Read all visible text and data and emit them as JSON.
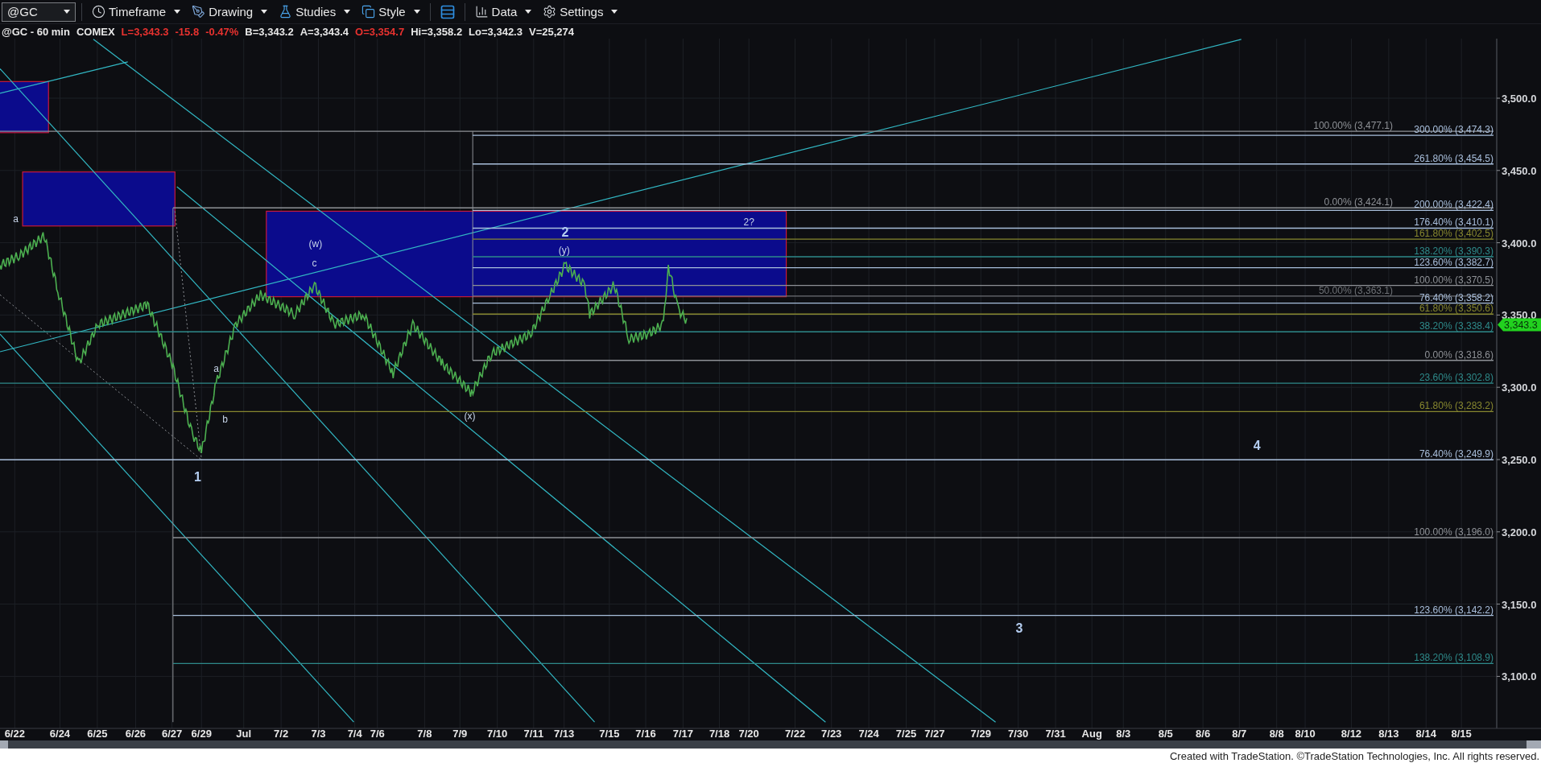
{
  "toolbar": {
    "symbol": "@GC",
    "menus": [
      {
        "label": "Timeframe",
        "kind": "clock"
      },
      {
        "label": "Drawing",
        "kind": "pen"
      },
      {
        "label": "Studies",
        "kind": "flask"
      },
      {
        "label": "Style",
        "kind": "layers"
      },
      {
        "label": "Data",
        "kind": "bars"
      },
      {
        "label": "Settings",
        "kind": "gear"
      }
    ]
  },
  "quote_line": [
    {
      "text": "@GC - 60 min",
      "color": "#e8e8e8"
    },
    {
      "text": "COMEX",
      "color": "#e8e8e8"
    },
    {
      "text": "L=3,343.3",
      "color": "#e8322f"
    },
    {
      "text": "-15.8",
      "color": "#e8322f"
    },
    {
      "text": "-0.47%",
      "color": "#e8322f"
    },
    {
      "text": "B=3,343.2",
      "color": "#e8e8e8"
    },
    {
      "text": "A=3,343.4",
      "color": "#e8e8e8"
    },
    {
      "text": "O=3,354.7",
      "color": "#e8322f"
    },
    {
      "text": "Hi=3,358.2",
      "color": "#e8e8e8"
    },
    {
      "text": "Lo=3,342.3",
      "color": "#e8e8e8"
    },
    {
      "text": "V=25,274",
      "color": "#e8e8e8"
    }
  ],
  "fib_levels": [
    {
      "label": "100.00% (3,477.1)",
      "color": "#8e9196"
    },
    {
      "label": "300.00% (3,474.3)",
      "color": "#a9bfdc"
    },
    {
      "label": "261.80% (3,454.5)",
      "color": "#a9bfdc"
    },
    {
      "label": "0.00% (3,424.1)",
      "color": "#8e9196"
    },
    {
      "label": "200.00% (3,422.4)",
      "color": "#a9bfdc"
    },
    {
      "label": "176.40% (3,410.1)",
      "color": "#a9bfdc"
    },
    {
      "label": "161.80% (3,402.5)",
      "color": "#87872f"
    },
    {
      "label": "138.20% (3,390.3)",
      "color": "#2e8a8a"
    },
    {
      "label": "123.60% (3,382.7)",
      "color": "#a9bfdc"
    },
    {
      "label": "100.00% (3,370.5)",
      "color": "#8e9196"
    },
    {
      "label": "50.00% (3,363.1)",
      "color": "#6e7176"
    },
    {
      "label": "76.40% (3,358.2)",
      "color": "#a9bfdc"
    },
    {
      "label": "61.80% (3,350.6)",
      "color": "#87872f"
    },
    {
      "label": "38.20% (3,338.4)",
      "color": "#2e8a8a"
    },
    {
      "label": "0.00% (3,318.6)",
      "color": "#8e9196"
    },
    {
      "label": "23.60% (3,302.8)",
      "color": "#2e8a8a"
    },
    {
      "label": "61.80% (3,283.2)",
      "color": "#87872f"
    },
    {
      "label": "76.40% (3,249.9)",
      "color": "#a9bfdc"
    },
    {
      "label": "100.00% (3,196.0)",
      "color": "#8e9196"
    },
    {
      "label": "123.60% (3,142.2)",
      "color": "#a9bfdc"
    },
    {
      "label": "138.20% (3,108.9)",
      "color": "#2e8a8a"
    }
  ],
  "wave_labels": [
    {
      "text": "a",
      "kind": "minor"
    },
    {
      "text": "(w)",
      "kind": "minor"
    },
    {
      "text": "c",
      "kind": "minor"
    },
    {
      "text": "2",
      "kind": "major"
    },
    {
      "text": "(y)",
      "kind": "minor"
    },
    {
      "text": "2?",
      "kind": "minor"
    },
    {
      "text": "a",
      "kind": "minor"
    },
    {
      "text": "b",
      "kind": "minor"
    },
    {
      "text": "(x)",
      "kind": "minor"
    },
    {
      "text": "1",
      "kind": "major"
    },
    {
      "text": "4",
      "kind": "major"
    },
    {
      "text": "3",
      "kind": "major"
    }
  ],
  "price_axis": [
    "3,500.0",
    "3,450.0",
    "3,400.0",
    "3,350.0",
    "3,300.0",
    "3,250.0",
    "3,200.0",
    "3,150.0",
    "3,100.0"
  ],
  "last_price": "3,343.3",
  "date_axis": [
    "6/22",
    "6/24",
    "6/25",
    "6/26",
    "6/27",
    "6/29",
    "Jul",
    "7/2",
    "7/3",
    "7/4",
    "7/6",
    "7/8",
    "7/9",
    "7/10",
    "7/11",
    "7/13",
    "7/15",
    "7/16",
    "7/17",
    "7/18",
    "7/20",
    "7/22",
    "7/23",
    "7/24",
    "7/25",
    "7/27",
    "7/29",
    "7/30",
    "7/31",
    "Aug",
    "8/3",
    "8/5",
    "8/6",
    "8/7",
    "8/8",
    "8/10",
    "8/12",
    "8/13",
    "8/14",
    "8/15"
  ],
  "footer": "Created with TradeStation. ©TradeStation Technologies, Inc. All rights reserved."
}
